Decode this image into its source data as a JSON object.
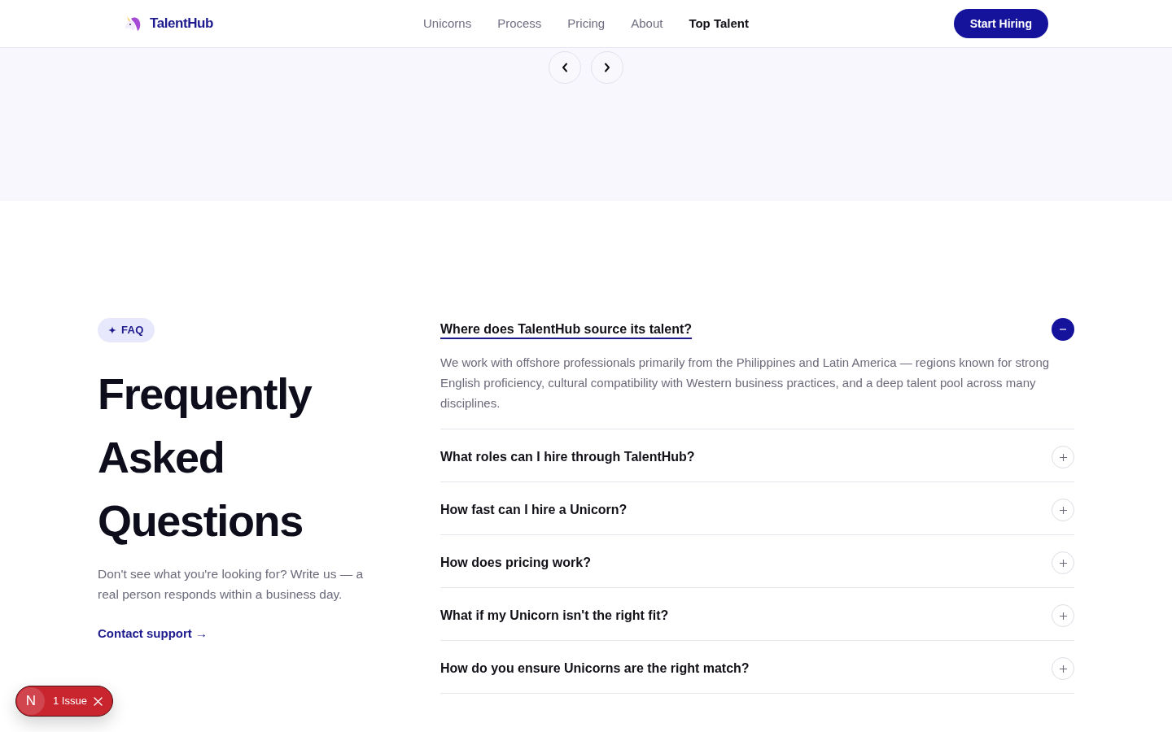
{
  "header": {
    "brand": "TalentHub",
    "nav": [
      {
        "label": "Unicorns",
        "selected": false
      },
      {
        "label": "Process",
        "selected": false
      },
      {
        "label": "Pricing",
        "selected": false
      },
      {
        "label": "About",
        "selected": false
      },
      {
        "label": "Top Talent",
        "selected": true
      }
    ],
    "cta": "Start Hiring"
  },
  "faq": {
    "badge": "FAQ",
    "heading": "Frequently Asked Questions",
    "intro": "Don't see what you're looking for? Write us — a real person responds within a business day.",
    "contact_link": "Contact support →",
    "items": [
      {
        "question": "Where does TalentHub source its talent?",
        "answer": "We work with offshore professionals primarily from the Philippines and Latin America — regions known for strong English proficiency, cultural compatibility with Western business practices, and a deep talent pool across many disciplines.",
        "expanded": true,
        "focused": true
      },
      {
        "question": "What roles can I hire through TalentHub?",
        "expanded": false,
        "focused": false
      },
      {
        "question": "How fast can I hire a Unicorn?",
        "expanded": false,
        "focused": false
      },
      {
        "question": "How does pricing work?",
        "expanded": false,
        "focused": false
      },
      {
        "question": "What if my Unicorn isn't the right fit?",
        "expanded": false,
        "focused": false
      },
      {
        "question": "How do you ensure Unicorns are the right match?",
        "expanded": false,
        "focused": false
      }
    ]
  },
  "dev_indicator": {
    "logo_letter": "N",
    "label": "1 Issue"
  }
}
